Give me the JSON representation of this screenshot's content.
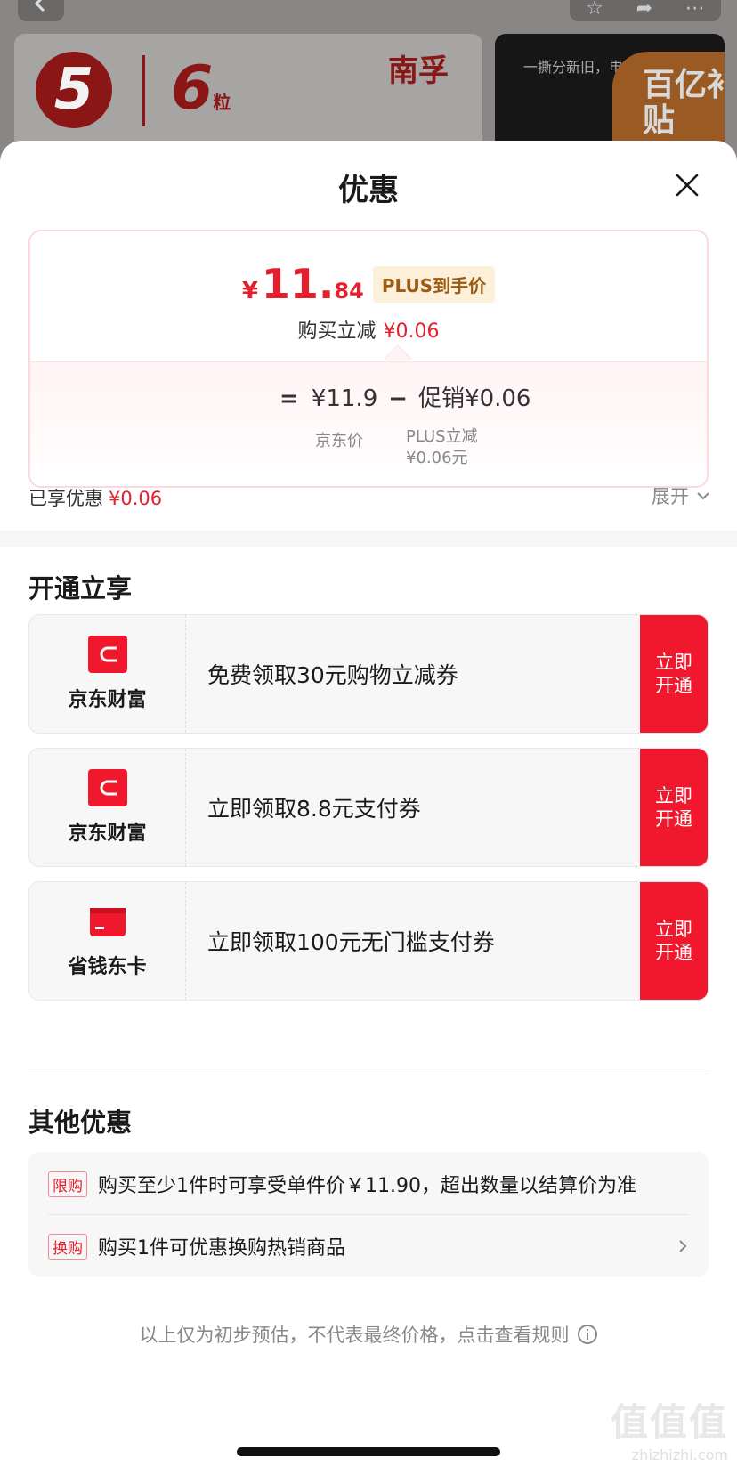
{
  "background": {
    "five": "5",
    "six": "6",
    "six_unit": "粒",
    "brand": "南孚",
    "promo_text": "一撕分新旧，电池",
    "badge_text": "百亿补贴"
  },
  "sheet": {
    "title": "优惠"
  },
  "price_summary": {
    "currency": "¥",
    "price_int": "11.",
    "price_dec": "84",
    "plus_tag": "PLUS到手价",
    "reduce_label": "购买立减",
    "reduce_value": "¥0.06",
    "formula_eq": "=",
    "jd_price": "¥11.9",
    "formula_minus": "−",
    "promo_value": "促销¥0.06",
    "jd_price_label": "京东价",
    "plus_reduce_label": "PLUS立减",
    "plus_reduce_value": "¥0.06元"
  },
  "enjoyed": {
    "label": "已享优惠",
    "value": "¥0.06",
    "expand": "展开"
  },
  "open_section": {
    "title": "开通立享",
    "offers": [
      {
        "name": "京东财富",
        "icon": "wallet-icon",
        "text": "免费领取30元购物立减券",
        "button": "立即开通"
      },
      {
        "name": "京东财富",
        "icon": "wallet-icon",
        "text": "立即领取8.8元支付券",
        "button": "立即开通"
      },
      {
        "name": "省钱东卡",
        "icon": "card-icon",
        "text": "立即领取100元无门槛支付券",
        "button": "立即开通"
      }
    ]
  },
  "other_section": {
    "title": "其他优惠",
    "rows": [
      {
        "tag": "限购",
        "text": "购买至少1件时可享受单件价￥11.90，超出数量以结算价为准"
      },
      {
        "tag": "换购",
        "text": "购买1件可优惠换购热销商品"
      }
    ]
  },
  "footnote": "以上仅为初步预估，不代表最终价格，点击查看规则",
  "watermark": {
    "text": "值值值",
    "url": "zhizhizhi.com"
  },
  "colors": {
    "accent_red": "#e4202f",
    "button_red": "#f0182c"
  }
}
